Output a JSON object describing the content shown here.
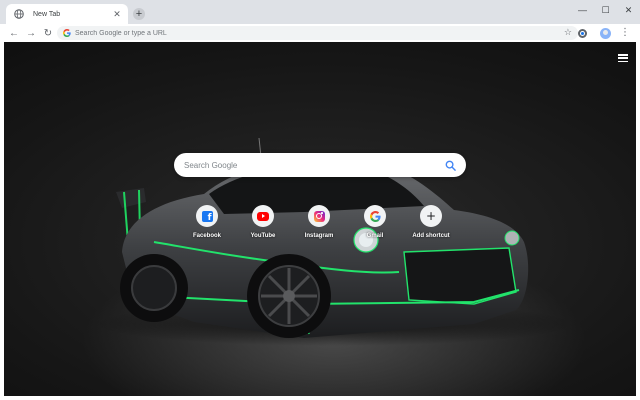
{
  "browser": {
    "tab": {
      "title": "New Tab",
      "close_glyph": "✕"
    },
    "new_tab_glyph": "+",
    "window_controls": {
      "minimize": "—",
      "maximize": "☐",
      "close": "✕"
    },
    "nav": {
      "back": "←",
      "forward": "→",
      "reload": "↻"
    },
    "omnibox": {
      "placeholder": "Search Google or type a URL",
      "value": "",
      "star": "☆"
    },
    "menu": "⋮"
  },
  "new_tab_page": {
    "search": {
      "placeholder": "Search Google"
    },
    "shortcuts": [
      {
        "label": "Facebook",
        "icon": "facebook-icon"
      },
      {
        "label": "YouTube",
        "icon": "youtube-icon"
      },
      {
        "label": "Instagram",
        "icon": "instagram-icon"
      },
      {
        "label": "Gmail",
        "icon": "google-icon"
      },
      {
        "label": "Add shortcut",
        "icon": "plus-icon",
        "glyph": "+"
      }
    ]
  },
  "colors": {
    "tabstrip": "#dee1e6",
    "accent_green": "#22e36b",
    "google_blue": "#4285f4",
    "google_red": "#ea4335",
    "google_yellow": "#fbbc05",
    "google_green": "#34a853"
  }
}
